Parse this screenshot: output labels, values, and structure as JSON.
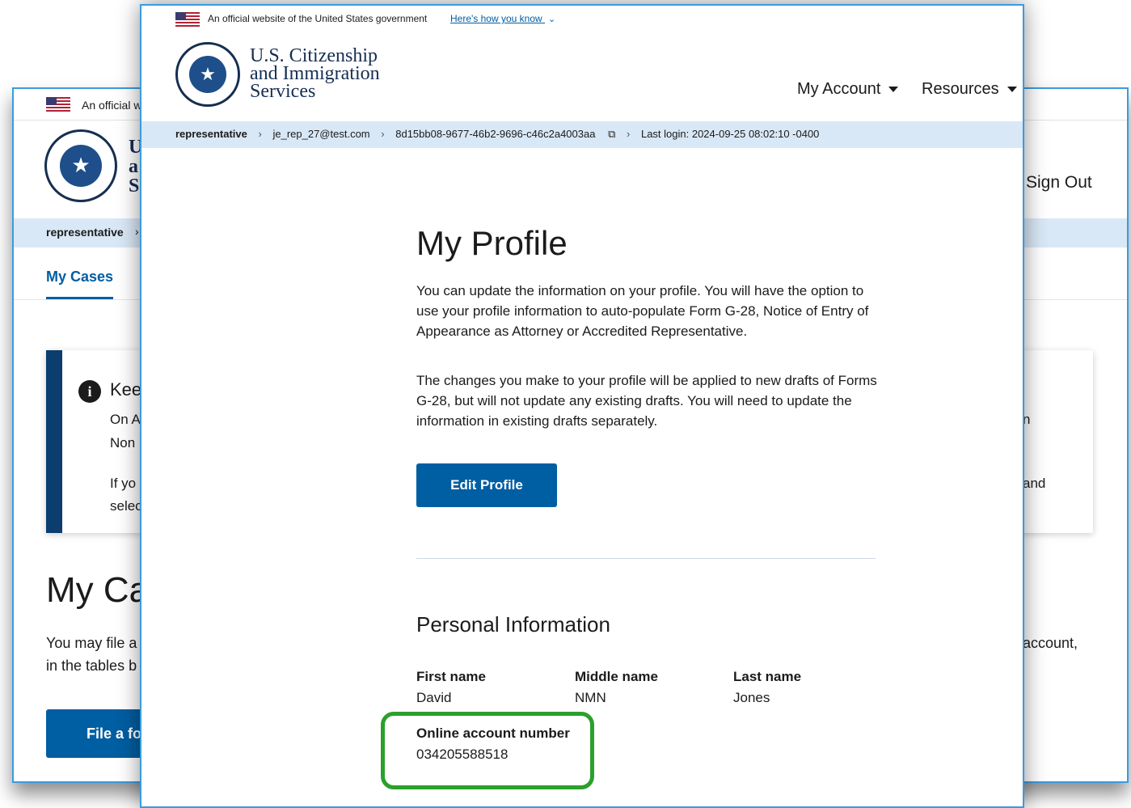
{
  "background": {
    "banner_text": "An official w",
    "agency_letters": [
      "U",
      "a",
      "S"
    ],
    "breadcrumb_role": "representative",
    "tab_my_cases": "My Cases",
    "sign_out": "Sign Out",
    "alert_title": "Kee",
    "alert_lines": [
      "On A",
      "Non",
      "If yo",
      "selec"
    ],
    "alert_right": [
      "n",
      "and"
    ],
    "heading": "My Ca",
    "body_lines": [
      "You may file a",
      "in the tables b"
    ],
    "body_right": "account,",
    "button": "File a fo"
  },
  "banner": {
    "text": "An official website of the United States government",
    "link": "Here's how you know"
  },
  "agency": {
    "line1": "U.S. Citizenship",
    "line2": "and Immigration",
    "line3": "Services"
  },
  "nav": {
    "my_account": "My Account",
    "resources": "Resources"
  },
  "breadcrumb": {
    "role": "representative",
    "email": "je_rep_27@test.com",
    "id": "8d15bb08-9677-46b2-9696-c46c2a4003aa",
    "last_login": "Last login: 2024-09-25 08:02:10 -0400"
  },
  "profile": {
    "title": "My Profile",
    "intro": "You can update the information on your profile. You will have the option to use your profile information to auto-populate Form G-28, Notice of Entry of Appearance as Attorney or Accredited Representative.",
    "changes": "The changes you make to your profile will be applied to new drafts of Forms G-28, but will not update any existing drafts. You will need to update the information in existing drafts separately.",
    "edit_button": "Edit Profile",
    "section_title": "Personal Information",
    "first_name_label": "First name",
    "first_name": "David",
    "middle_name_label": "Middle name",
    "middle_name": "NMN",
    "last_name_label": "Last name",
    "last_name": "Jones",
    "account_label": "Online account number",
    "account_number": "034205588518"
  },
  "colors": {
    "primary": "#005ea2",
    "navy": "#162e51",
    "crumb_bg": "#d9e8f6",
    "highlight": "#2ba02b",
    "window_border": "#3a9be0"
  }
}
